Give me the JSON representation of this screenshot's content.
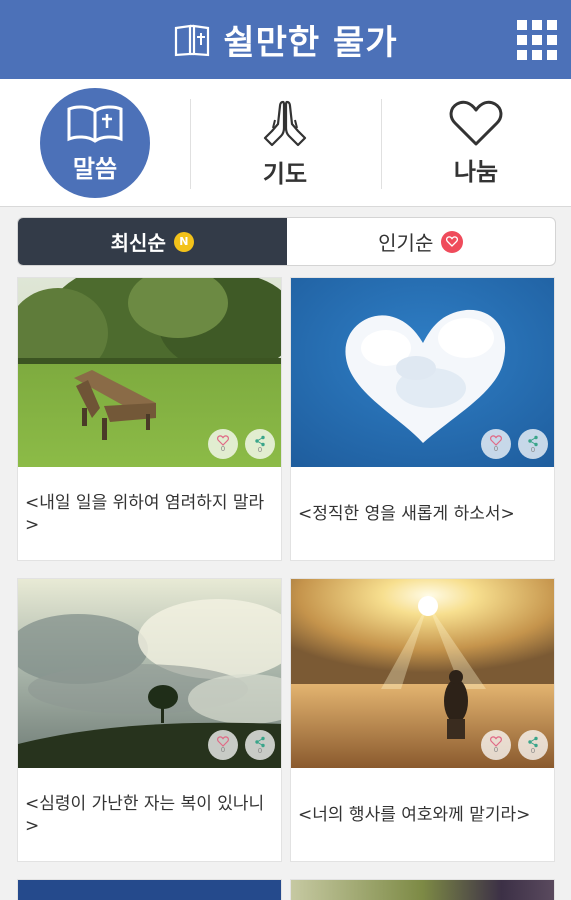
{
  "app": {
    "title": "쉴만한 물가",
    "logo_icon": "bible-icon",
    "menu_icon": "grid-menu-icon"
  },
  "categories": [
    {
      "label": "말씀",
      "icon": "open-book-icon",
      "active": true
    },
    {
      "label": "기도",
      "icon": "praying-hands-icon",
      "active": false
    },
    {
      "label": "나눔",
      "icon": "heart-outline-icon",
      "active": false
    }
  ],
  "sort": {
    "latest_label": "최신순",
    "latest_badge": "N",
    "popular_label": "인기순"
  },
  "posts": [
    {
      "caption": "<내일 일을 위하여 염려하지 말라>",
      "likes": "0",
      "shares": "0",
      "image": "park-bench-photo"
    },
    {
      "caption": "<정직한 영을 새롭게 하소서>",
      "likes": "0",
      "shares": "0",
      "image": "heart-cloud-photo"
    },
    {
      "caption": "<심령이 가난한 자는 복이 있나니>",
      "likes": "0",
      "shares": "0",
      "image": "lone-tree-photo"
    },
    {
      "caption": "<너의 행사를 여호와께 맡기라>",
      "likes": "0",
      "shares": "0",
      "image": "praying-man-sunset-photo"
    }
  ],
  "colors": {
    "brand": "#4c71b8",
    "sort_active": "#333b48",
    "badge_new": "#f3c21a",
    "badge_heart": "#ef4b5b"
  }
}
